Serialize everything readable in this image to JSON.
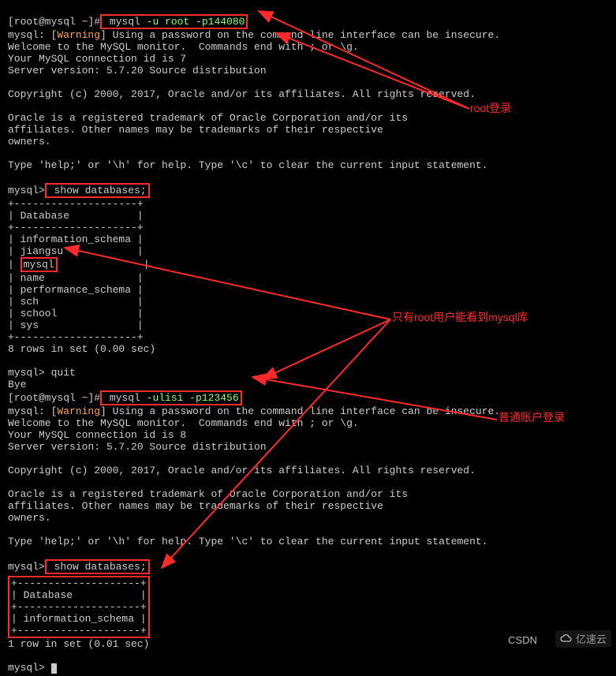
{
  "line1_prompt": "[root@mysql ~]#",
  "line1_cmd": " mysql ",
  "line1_opts": "-u root -p144080",
  "warning_prefix": "mysql: [",
  "warning_word": "Warning",
  "warning_suffix": "] Using a password on the command line interface can be insecure.",
  "welcome1": "Welcome to the MySQL monitor.  Commands end with ; or \\g.",
  "connid1": "Your MySQL connection id is 7",
  "version": "Server version: 5.7.20 Source distribution",
  "copyright": "Copyright (c) 2000, 2017, Oracle and/or its affiliates. All rights reserved.",
  "trademark1": "Oracle is a registered trademark of Oracle Corporation and/or its",
  "trademark2": "affiliates. Other names may be trademarks of their respective",
  "trademark3": "owners.",
  "help": "Type 'help;' or '\\h' for help. Type '\\c' to clear the current input statement.",
  "mysql_prompt": "mysql>",
  "showdb": " show databases;",
  "tbl_sep": "+--------------------+",
  "tbl_head": "| Database           |",
  "tbl_r1": "| information_schema |",
  "tbl_r2": "| jiangsu            |",
  "tbl_r3_pre": "| ",
  "tbl_r3_val": "mysql",
  "tbl_r3_post": "              |",
  "tbl_r4": "| name               |",
  "tbl_r5": "| performance_schema |",
  "tbl_r6": "| sch                |",
  "tbl_r7": "| school             |",
  "tbl_r8": "| sys                |",
  "rows1": "8 rows in set (0.00 sec)",
  "quit": " quit",
  "bye": "Bye",
  "line2_prompt": "[root@mysql ~]#",
  "line2_cmd": " mysql ",
  "line2_opts": "-ulisi -p123456",
  "connid2": "Your MySQL connection id is 8",
  "tbl2_sep": "+--------------------+",
  "tbl2_head": "| Database           |",
  "tbl2_r1": "| information_schema |",
  "rows2": "1 row in set (0.01 sec)",
  "ann_root": "root登录",
  "ann_mysql": "只有root用户能看到mysql库",
  "ann_normal": "普通账户登录",
  "wm_csdn": "CSDN",
  "wm_brand": "亿速云"
}
